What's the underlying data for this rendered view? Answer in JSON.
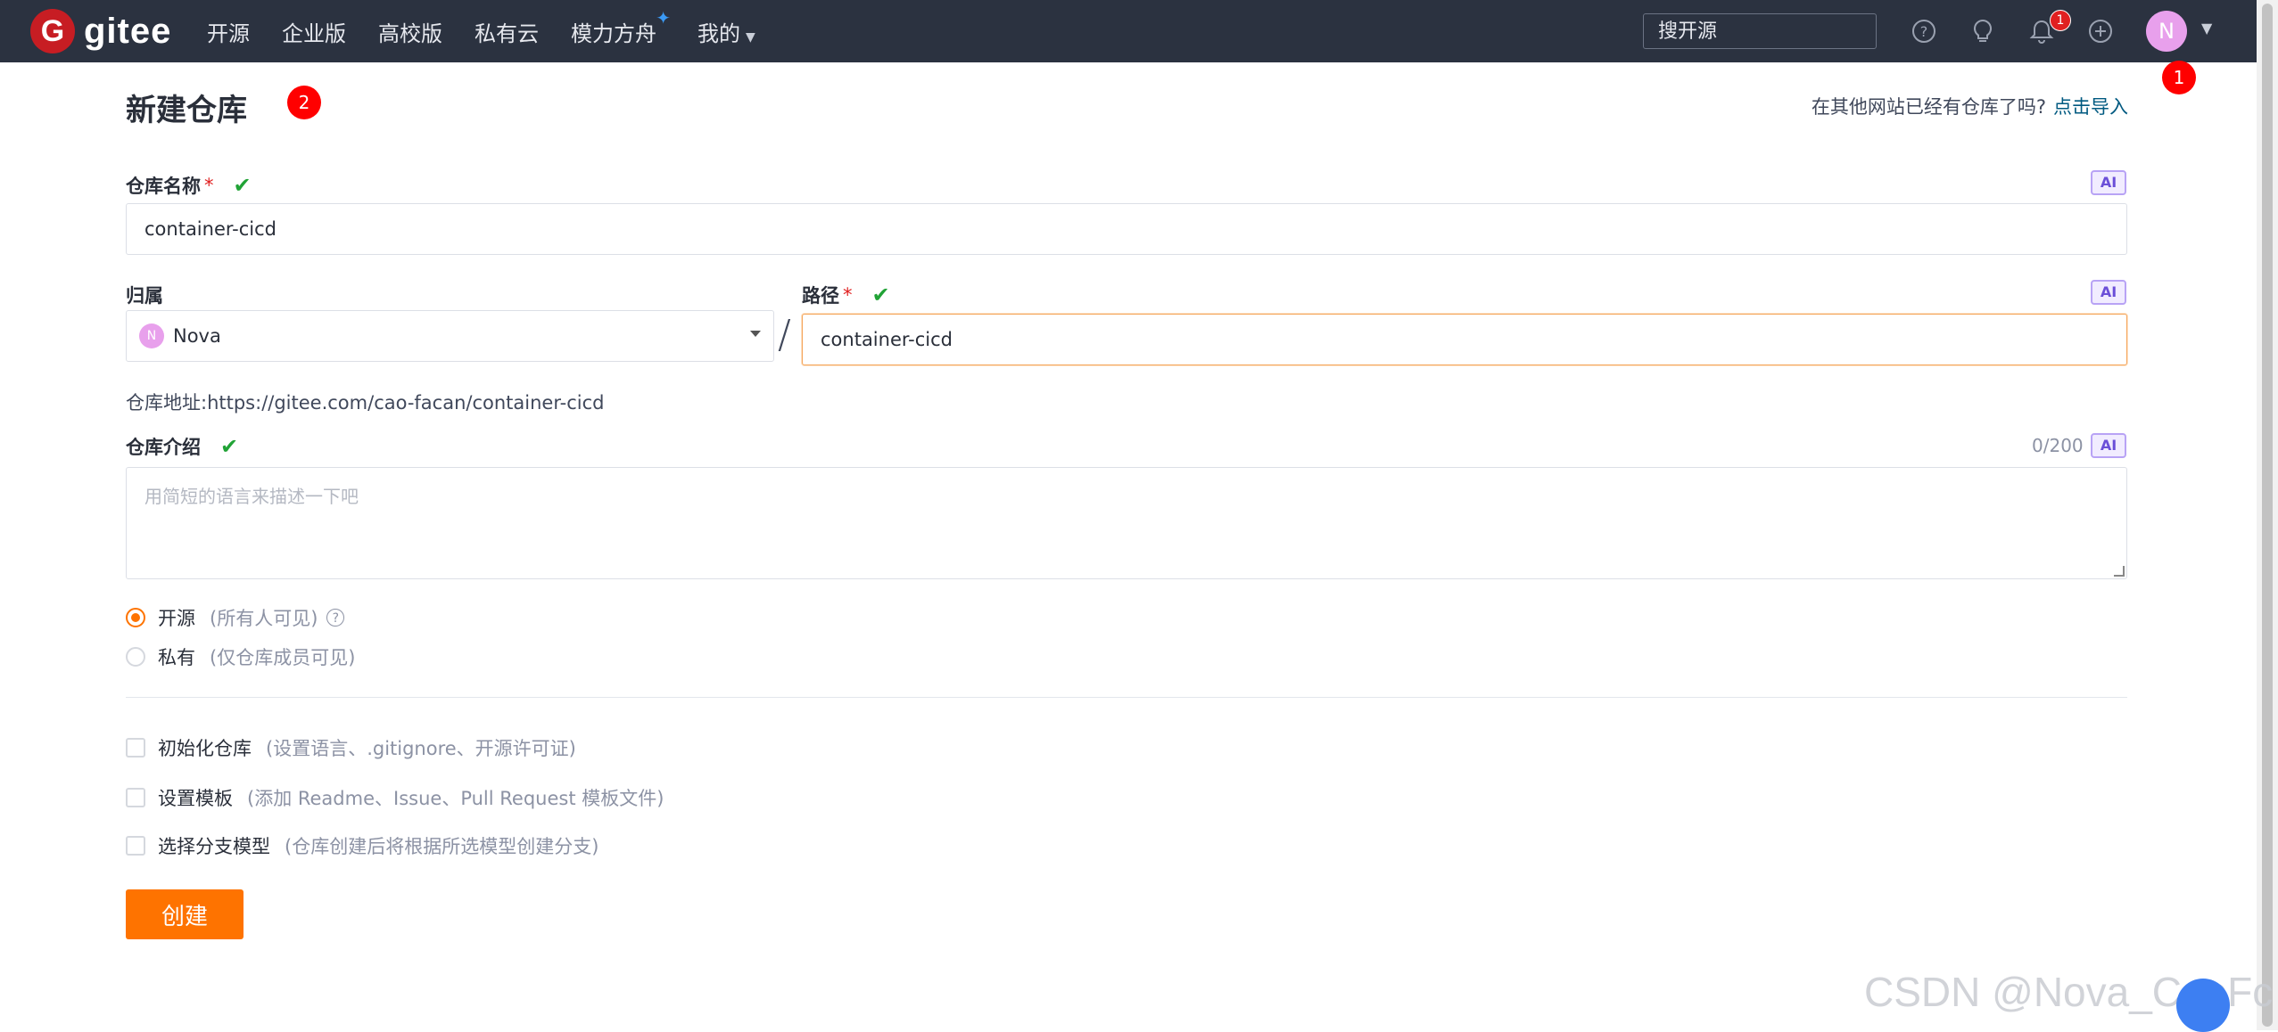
{
  "header": {
    "logo_text": "gitee",
    "logo_mark": "G",
    "nav": [
      {
        "label": "开源"
      },
      {
        "label": "企业版"
      },
      {
        "label": "高校版"
      },
      {
        "label": "私有云"
      },
      {
        "label": "模力方舟"
      },
      {
        "label": "我的"
      }
    ],
    "search_placeholder": "搜开源",
    "notification_count": "1",
    "avatar_initial": "N",
    "icons": [
      "help-icon",
      "lightbulb-icon",
      "bell-icon",
      "plus-circle-icon"
    ]
  },
  "markers": {
    "one": "1",
    "two": "2"
  },
  "page": {
    "title": "新建仓库",
    "import_hint": "在其他网站已经有仓库了吗?",
    "import_link": "点击导入"
  },
  "form": {
    "repo_name": {
      "label": "仓库名称",
      "required": "*",
      "value": "container-cicd",
      "ai": "AI"
    },
    "owner": {
      "label": "归属",
      "value": "Nova",
      "avatar_initial": "N"
    },
    "separator": "/",
    "path": {
      "label": "路径",
      "required": "*",
      "value": "container-cicd",
      "ai": "AI"
    },
    "address": "仓库地址:https://gitee.com/cao-facan/container-cicd",
    "intro": {
      "label": "仓库介绍",
      "counter": "0/200",
      "ai": "AI",
      "placeholder": "用简短的语言来描述一下吧"
    },
    "visibility": [
      {
        "label": "开源",
        "hint": "(所有人可见)",
        "selected": true
      },
      {
        "label": "私有",
        "hint": "(仅仓库成员可见)",
        "selected": false
      }
    ],
    "options": [
      {
        "label": "初始化仓库",
        "hint": "(设置语言、.gitignore、开源许可证)"
      },
      {
        "label": "设置模板",
        "hint": "(添加 Readme、Issue、Pull Request 模板文件)"
      },
      {
        "label": "选择分支模型",
        "hint": "(仓库创建后将根据所选模型创建分支)"
      }
    ],
    "submit": "创建"
  },
  "watermark": "CSDN @Nova_CaoFc",
  "colors": {
    "nav_bg": "#2b3240",
    "accent": "#fe7300",
    "brand": "#c71d23",
    "link": "#005980",
    "success": "#21a336"
  }
}
